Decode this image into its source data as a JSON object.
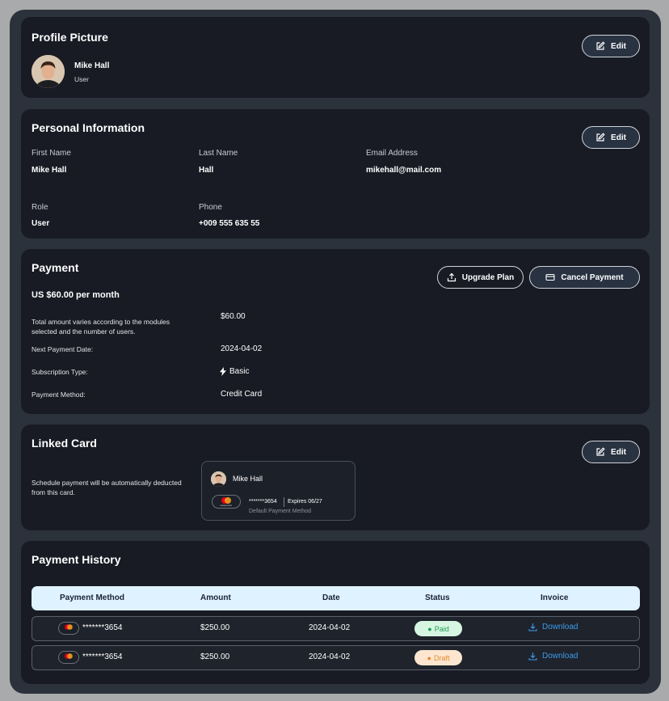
{
  "profile_picture": {
    "title": "Profile Picture",
    "name": "Mike Hall",
    "role": "User",
    "edit_label": "Edit"
  },
  "personal_information": {
    "title": "Personal Information",
    "edit_label": "Edit",
    "fields": [
      {
        "label": "First Name",
        "value": "Mike Hall"
      },
      {
        "label": "Last Name",
        "value": "Hall"
      },
      {
        "label": "Email Address",
        "value": "mikehall@mail.com"
      },
      {
        "label": "Role",
        "value": "User"
      },
      {
        "label": "Phone",
        "value": "+009 555 635 55"
      }
    ]
  },
  "payment": {
    "title": "Payment",
    "price": "US $60.00 per month",
    "upgrade_label": "Upgrade Plan",
    "cancel_label": "Cancel Payment",
    "note": "Total amount varies according to the modules selected and the number of users.",
    "amount": "$60.00",
    "next_date_label": "Next Payment Date:",
    "next_date": "2024-04-02",
    "subscription_label": "Subscription Type:",
    "subscription": "Basic",
    "method_label": "Payment Method:",
    "method": "Credit Card"
  },
  "linked_card": {
    "title": "Linked Card",
    "edit_label": "Edit",
    "note": "Schedule payment will be automatically deducted from this card.",
    "holder": "Mike Hall",
    "number": "*******3654",
    "expires": "Expires 06/27",
    "default_label": "Default Payment Method",
    "brand_text": "mastercard"
  },
  "payment_history": {
    "title": "Payment History",
    "columns": [
      "Payment Method",
      "Amount",
      "Date",
      "Status",
      "Invoice"
    ],
    "rows": [
      {
        "card": "*******3654",
        "amount": "$250.00",
        "date": "2024-04-02",
        "status": "Paid",
        "invoice": "Download"
      },
      {
        "card": "*******3654",
        "amount": "$250.00",
        "date": "2024-04-02",
        "status": "Draft",
        "invoice": "Download"
      }
    ]
  },
  "colors": {
    "background": "#2c323b",
    "card": "#181b24",
    "button": "#283241",
    "table_header": "#dff2ff",
    "paid_bg": "#d7f6e2",
    "paid_text": "#1f9d55",
    "draft_bg": "#fde6cf",
    "draft_text": "#e58a2a",
    "link": "#3b9be8"
  }
}
